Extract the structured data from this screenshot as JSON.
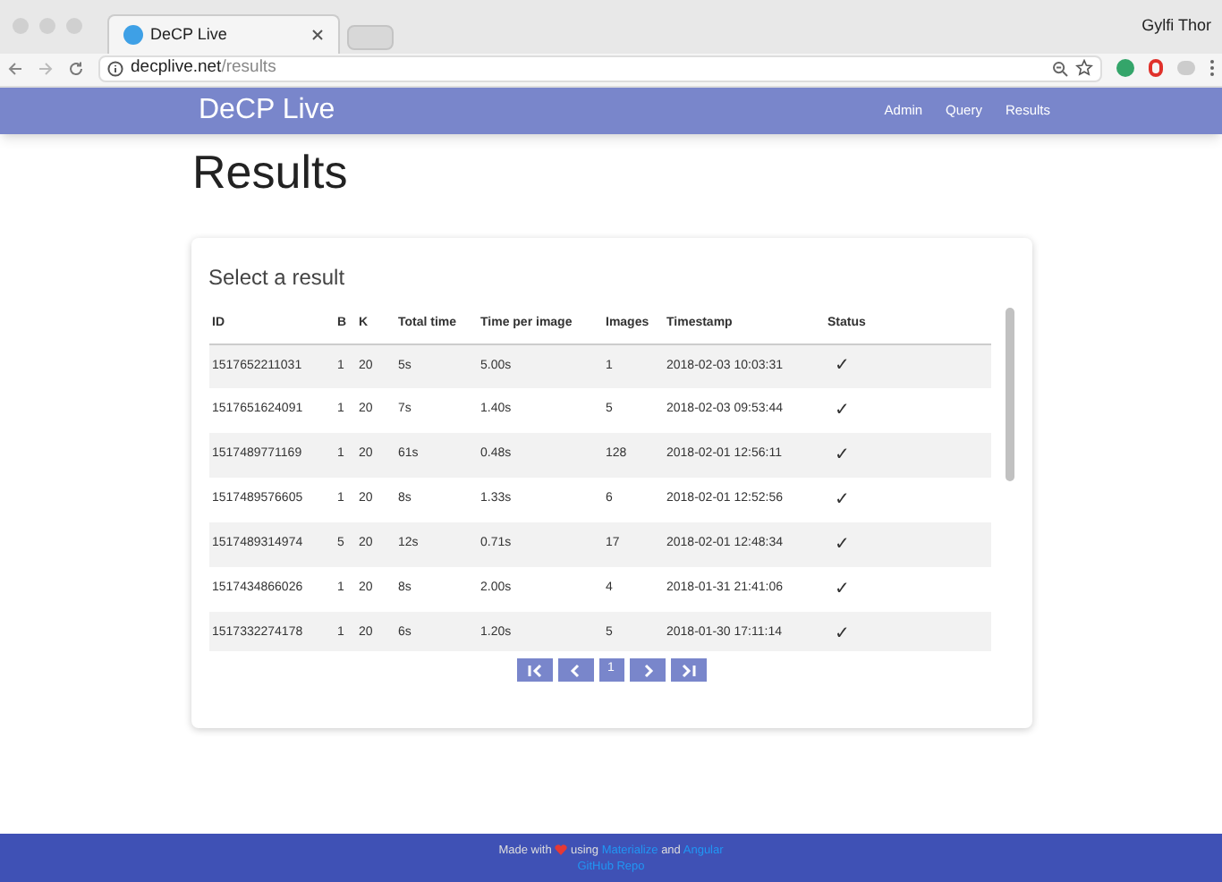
{
  "browser": {
    "tab_title": "DeCP Live",
    "profile": "Gylfi Thor",
    "url_host": "decplive.net",
    "url_path": "/results"
  },
  "navbar": {
    "brand": "DeCP Live",
    "links": [
      {
        "label": "Admin"
      },
      {
        "label": "Query"
      },
      {
        "label": "Results"
      }
    ]
  },
  "page_title": "Results",
  "card": {
    "title": "Select a result",
    "table": {
      "columns": [
        "ID",
        "B",
        "K",
        "Total time",
        "Time per image",
        "Images",
        "Timestamp",
        "Status"
      ],
      "rows": [
        [
          "1517652211031",
          "1",
          "20",
          "5s",
          "5.00s",
          "1",
          "2018-02-03 10:03:31",
          "✓"
        ],
        [
          "1517651624091",
          "1",
          "20",
          "7s",
          "1.40s",
          "5",
          "2018-02-03 09:53:44",
          "✓"
        ],
        [
          "1517489771169",
          "1",
          "20",
          "61s",
          "0.48s",
          "128",
          "2018-02-01 12:56:11",
          "✓"
        ],
        [
          "1517489576605",
          "1",
          "20",
          "8s",
          "1.33s",
          "6",
          "2018-02-01 12:52:56",
          "✓"
        ],
        [
          "1517489314974",
          "5",
          "20",
          "12s",
          "0.71s",
          "17",
          "2018-02-01 12:48:34",
          "✓"
        ],
        [
          "1517434866026",
          "1",
          "20",
          "8s",
          "2.00s",
          "4",
          "2018-01-31 21:41:06",
          "✓"
        ],
        [
          "1517332274178",
          "1",
          "20",
          "6s",
          "1.20s",
          "5",
          "2018-01-30 17:11:14",
          "✓"
        ]
      ]
    },
    "pagination": [
      {
        "kind": "first"
      },
      {
        "kind": "prev"
      },
      {
        "kind": "page",
        "label": "1"
      },
      {
        "kind": "next"
      },
      {
        "kind": "last"
      }
    ]
  },
  "footer": {
    "line": [
      {
        "kind": "text",
        "text": "Made with"
      },
      {
        "kind": "heart"
      },
      {
        "kind": "text",
        "text": "using"
      },
      {
        "kind": "link",
        "text": "Materialize"
      },
      {
        "kind": "text",
        "text": "and"
      },
      {
        "kind": "link",
        "text": "Angular"
      }
    ],
    "repo_link": "GitHub Repo"
  }
}
